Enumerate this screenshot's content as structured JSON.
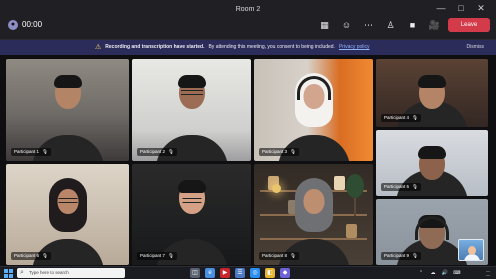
{
  "window": {
    "title": "Room 2",
    "controls": [
      "—",
      "□",
      "✕"
    ],
    "icons": [
      "minimize-icon",
      "maximize-icon",
      "close-icon"
    ]
  },
  "toolbar": {
    "timer": "00:00",
    "tools": [
      "▦",
      "☺",
      "⋯",
      "♙",
      "■",
      "🎥",
      "🎤",
      "⇪"
    ],
    "tool_names": [
      "chat-icon",
      "people-icon",
      "more-icon",
      "raise-hand-icon",
      "camera-icon",
      "mic-icon",
      "share-icon",
      "rooms-icon"
    ],
    "leave_label": "Leave"
  },
  "banner": {
    "icon": "⚠",
    "message_bold": "Recording and transcription have started.",
    "message": "By attending this meeting, you consent to being included.",
    "link": "Privacy policy",
    "dismiss": "Dismiss"
  },
  "participants": [
    {
      "label": "Participant 1",
      "mic": "🎙"
    },
    {
      "label": "Participant 2",
      "mic": "🎙"
    },
    {
      "label": "Participant 3",
      "mic": "🎙"
    },
    {
      "label": "Participant 4",
      "mic": "🎙"
    },
    {
      "label": "Participant 5",
      "mic": "🎙"
    },
    {
      "label": "Participant 6",
      "mic": "🎙"
    },
    {
      "label": "Participant 7",
      "mic": "🎙"
    },
    {
      "label": "Participant 8",
      "mic": "🎙"
    },
    {
      "label": "Participant 9",
      "mic": "🎙"
    }
  ],
  "taskbar": {
    "search_placeholder": "Type here to search",
    "apps": [
      "◫",
      "e",
      "▶",
      "☰",
      "◎",
      "◧",
      "◆"
    ],
    "app_colors": [
      "#5a6170",
      "#4a90e2",
      "#c9252d",
      "#4a78c2",
      "#2a8ef0",
      "#e6b52e",
      "#6e62d8"
    ],
    "tray_icons": [
      "⌃",
      "☁",
      "🔊",
      "⌨"
    ],
    "time": "—",
    "date": "—"
  }
}
